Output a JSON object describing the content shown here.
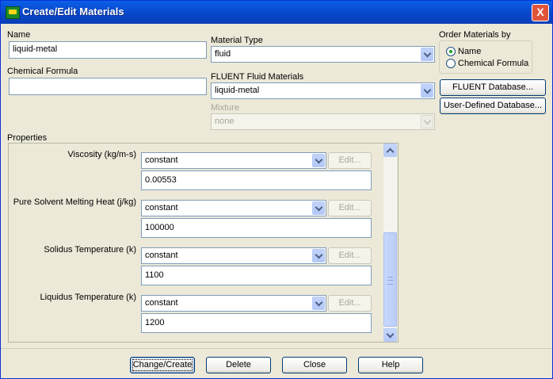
{
  "window": {
    "title": "Create/Edit Materials",
    "close_symbol": "X"
  },
  "name": {
    "label": "Name",
    "value": "liquid-metal"
  },
  "chemical_formula": {
    "label": "Chemical Formula",
    "value": ""
  },
  "material_type": {
    "label": "Material Type",
    "value": "fluid"
  },
  "fluent_materials": {
    "label": "FLUENT Fluid Materials",
    "value": "liquid-metal"
  },
  "mixture": {
    "label": "Mixture",
    "value": "none"
  },
  "order_by": {
    "label": "Order Materials by",
    "options": [
      {
        "label": "Name",
        "selected": true
      },
      {
        "label": "Chemical Formula",
        "selected": false
      }
    ]
  },
  "database_buttons": {
    "fluent": "FLUENT Database...",
    "user_defined": "User-Defined Database..."
  },
  "properties": {
    "label": "Properties",
    "items": [
      {
        "label": "Viscosity (kg/m-s)",
        "method": "constant",
        "edit": "Edit...",
        "value": "0.00553"
      },
      {
        "label": "Pure Solvent Melting Heat (j/kg)",
        "method": "constant",
        "edit": "Edit...",
        "value": "100000"
      },
      {
        "label": "Solidus Temperature (k)",
        "method": "constant",
        "edit": "Edit...",
        "value": "1100"
      },
      {
        "label": "Liquidus Temperature (k)",
        "method": "constant",
        "edit": "Edit...",
        "value": "1200"
      }
    ]
  },
  "footer": {
    "change_create": "Change/Create",
    "delete": "Delete",
    "close": "Close",
    "help": "Help"
  }
}
